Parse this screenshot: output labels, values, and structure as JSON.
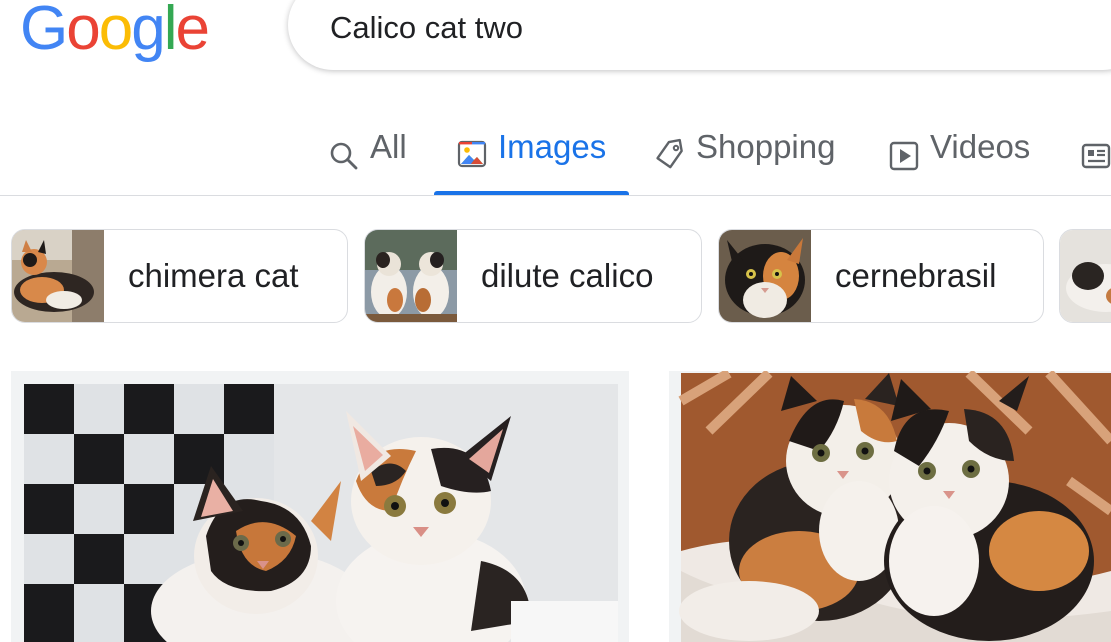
{
  "logo": {
    "letters": [
      "G",
      "o",
      "o",
      "g",
      "l",
      "e"
    ],
    "colors": [
      "#4285F4",
      "#EA4335",
      "#FBBC05",
      "#4285F4",
      "#34A853",
      "#EA4335"
    ]
  },
  "search": {
    "query": "Calico cat two"
  },
  "tabs": [
    {
      "label": "All",
      "icon": "search-icon",
      "active": false
    },
    {
      "label": "Images",
      "icon": "image-icon",
      "active": true
    },
    {
      "label": "Shopping",
      "icon": "tag-icon",
      "active": false
    },
    {
      "label": "Videos",
      "icon": "play-icon",
      "active": false
    },
    {
      "label": "",
      "icon": "news-icon",
      "active": false
    }
  ],
  "chips": [
    {
      "label": "chimera cat",
      "thumb": "calico-cat-lying-thumbnail"
    },
    {
      "label": "dilute calico",
      "thumb": "two-calico-cats-thumbnail"
    },
    {
      "label": "cernebrasil",
      "thumb": "calico-cat-face-thumbnail"
    },
    {
      "label": "",
      "thumb": "calico-cat-thumbnail"
    }
  ],
  "results": [
    {
      "alt": "two calico kittens"
    },
    {
      "alt": "two calico cats cuddling"
    }
  ],
  "colors": {
    "accent": "#1a73e8",
    "text_primary": "#202124",
    "text_secondary": "#5f6368",
    "border": "#dadce0"
  }
}
